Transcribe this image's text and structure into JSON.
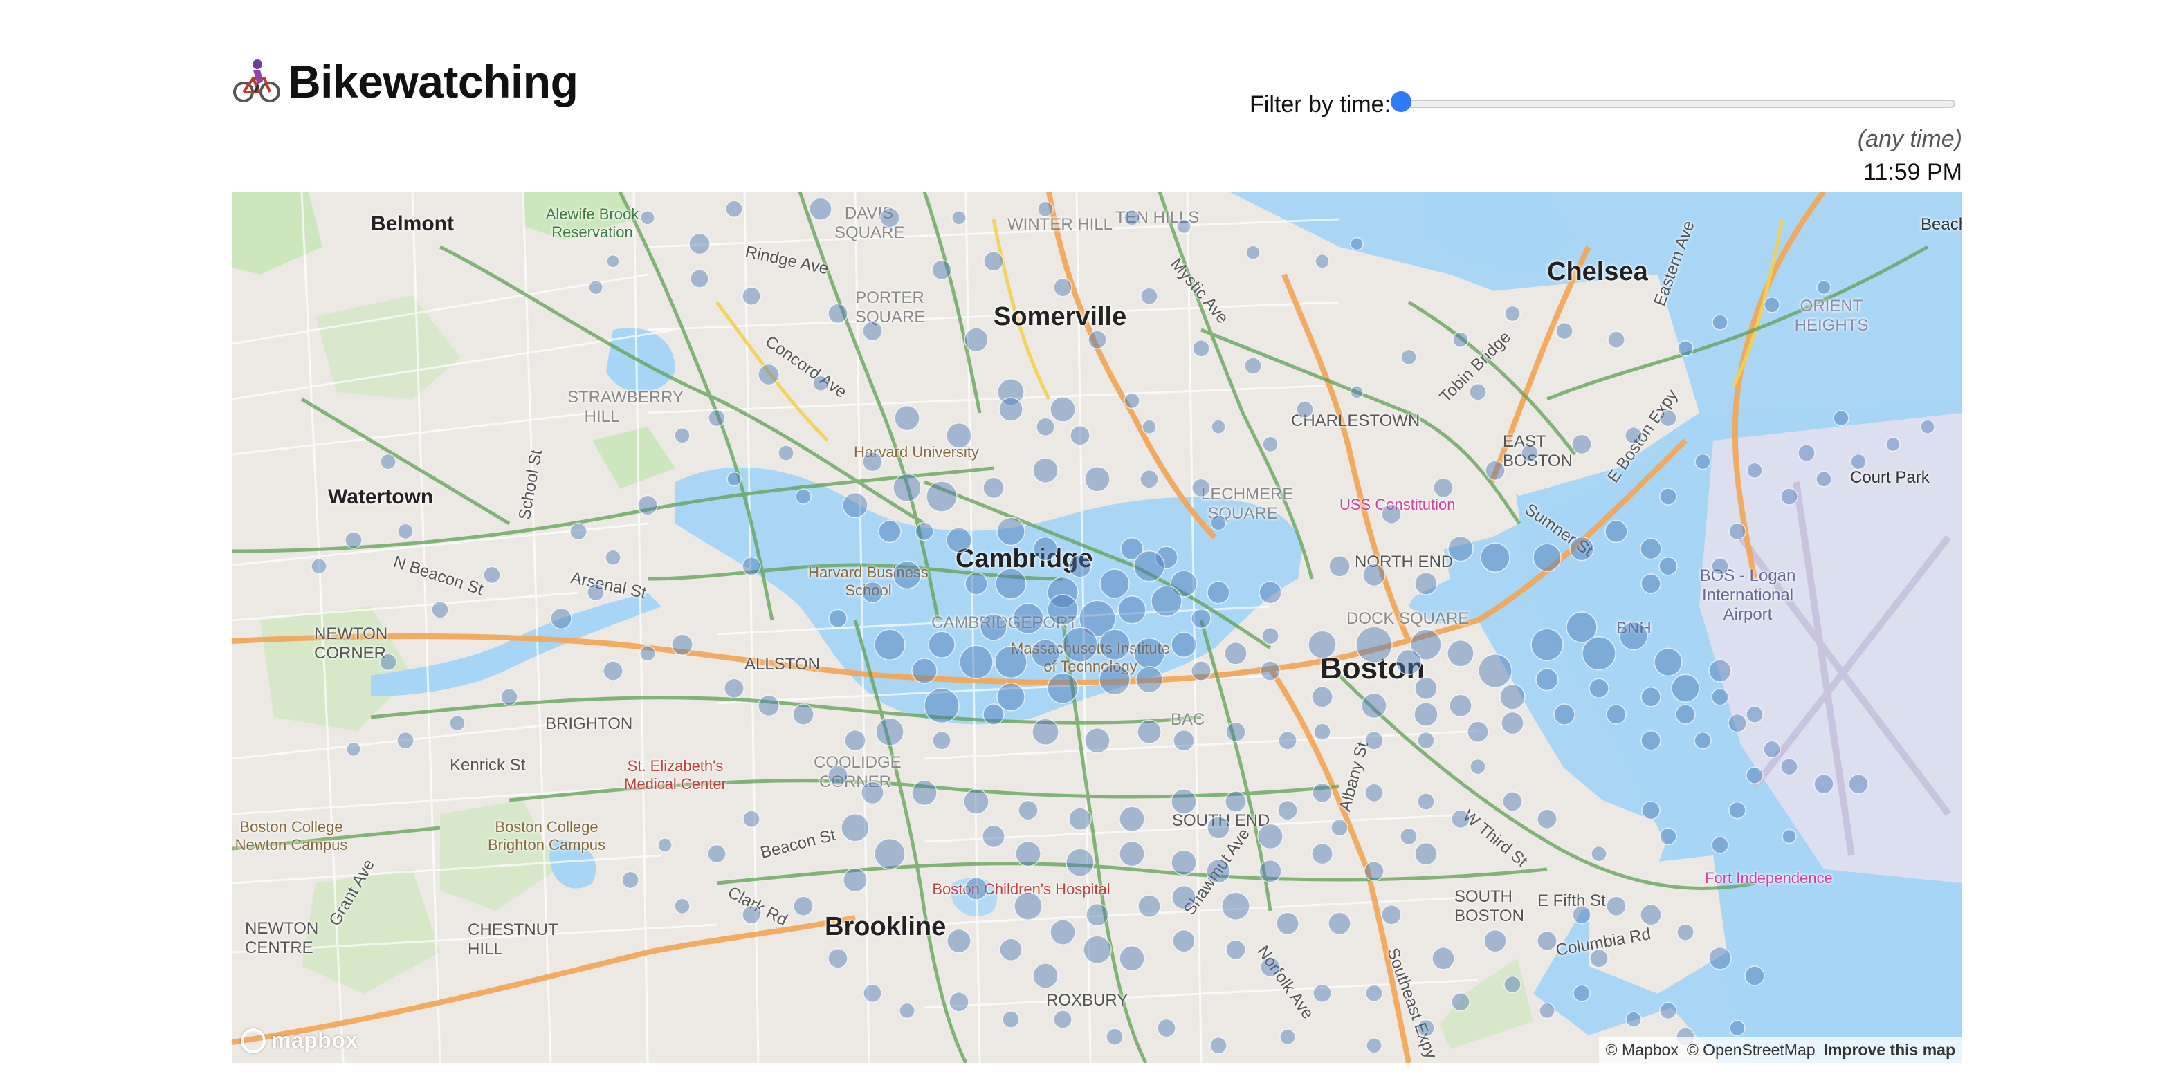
{
  "app": {
    "title": "Bikewatching",
    "title_icon": "bicycle-rider-icon"
  },
  "filter": {
    "label": "Filter by time:",
    "slider_value_fraction": 0.0,
    "any_time_text": "(any time)",
    "time_text": "11:59 PM",
    "accent_color": "#2f7bf5"
  },
  "map": {
    "labels": {
      "belmont": "Belmont",
      "alewife": "Alewife Brook Reservation",
      "somerville": "Somerville",
      "chelsea": "Chelsea",
      "watertown": "Watertown",
      "cambridge": "Cambridge",
      "boston": "Boston",
      "brookline": "Brookline",
      "harvard_university": "Harvard University",
      "harvard_business_school": "Harvard Business School",
      "mit": "Massachusetts Institute of Technology",
      "brighton": "BRIGHTON",
      "allston": "ALLSTON",
      "newton_corner": "NEWTON CORNER",
      "newton_centre": "NEWTON CENTRE",
      "chestnut_hill": "CHESTNUT HILL",
      "st_elizabeths": "St. Elizabeth's Medical Center",
      "boston_college_newton": "Boston College Newton Campus",
      "boston_college_brighton": "Boston College Brighton Campus",
      "childrens_hospital": "Boston Children's Hospital",
      "charlestown": "CHARLESTOWN",
      "east_boston": "EAST BOSTON",
      "north_end": "NORTH END",
      "south_end": "SOUTH END",
      "south_boston": "SOUTH BOSTON",
      "roxbury": "ROXBURY",
      "uss_constitution": "USS Constitution",
      "logan_airport": "BOS - Logan International Airport",
      "bnh": "BNH",
      "fort_independence": "Fort Independence",
      "court_park": "Court Park",
      "beach": "Beach",
      "orient_heights": "ORIENT HEIGHTS",
      "rindge_ave": "Rindge Ave",
      "concord_ave": "Concord Ave",
      "n_beacon_st": "N Beacon St",
      "arsenal_st": "Arsenal St",
      "kenrick_st": "Kenrick St",
      "beacon_st": "Beacon St",
      "clark_rd": "Clark Rd",
      "e_fifth_st": "E Fifth St",
      "columbia_rd": "Columbia Rd",
      "tobin_bridge": "Tobin Bridge",
      "strawberry_hill": "STRAWBERRY HILL",
      "porter_square": "PORTER SQUARE",
      "davis_square": "DAVIS SQUARE",
      "winter_hill": "WINTER HILL",
      "ten_hills": "TEN HILLS",
      "mystic_ave": "Mystic Ave",
      "eastern_ave": "Eastern Ave",
      "e_boston_expy": "E Boston Expy",
      "sumner_st": "Sumner St",
      "cambridgeport": "CAMBRIDGEPORT",
      "coolidge_corner": "COOLIDGE CORNER",
      "lechmere_square": "LECHMERE SQUARE",
      "dock_square": "DOCK SQUARE",
      "back_bay": "BAC",
      "w_third_st": "W Third St",
      "albany_st": "Albany St",
      "shawmut_ave": "Shawmut Ave",
      "norfolk_ave": "Norfolk Ave",
      "southeast_expy": "Southeast Expy",
      "grant_ave": "Grant Ave",
      "school_st": "School St"
    },
    "attribution": {
      "mapbox": "© Mapbox",
      "osm": "© OpenStreetMap",
      "improve": "Improve this map"
    },
    "logo_text": "mapbox",
    "station_color": "#4a78b5",
    "water_color": "#a6d5f5",
    "park_color": "#c9e7b8",
    "bikeway_color": "#5fa052",
    "highway_color": "#f2a85a"
  },
  "stations": [
    [
      0.24,
      0.03,
      10
    ],
    [
      0.29,
      0.02,
      12
    ],
    [
      0.34,
      0.02,
      16
    ],
    [
      0.38,
      0.03,
      14
    ],
    [
      0.42,
      0.03,
      10
    ],
    [
      0.47,
      0.02,
      11
    ],
    [
      0.52,
      0.03,
      11
    ],
    [
      0.55,
      0.04,
      10
    ],
    [
      0.59,
      0.07,
      10
    ],
    [
      0.63,
      0.08,
      10
    ],
    [
      0.65,
      0.06,
      9
    ],
    [
      0.27,
      0.06,
      15
    ],
    [
      0.27,
      0.1,
      13
    ],
    [
      0.22,
      0.08,
      9
    ],
    [
      0.21,
      0.11,
      10
    ],
    [
      0.3,
      0.12,
      13
    ],
    [
      0.35,
      0.14,
      14
    ],
    [
      0.41,
      0.09,
      14
    ],
    [
      0.44,
      0.08,
      14
    ],
    [
      0.48,
      0.11,
      13
    ],
    [
      0.53,
      0.12,
      12
    ],
    [
      0.37,
      0.16,
      14
    ],
    [
      0.43,
      0.17,
      17
    ],
    [
      0.45,
      0.23,
      19
    ],
    [
      0.48,
      0.25,
      18
    ],
    [
      0.5,
      0.17,
      13
    ],
    [
      0.52,
      0.24,
      11
    ],
    [
      0.56,
      0.18,
      12
    ],
    [
      0.59,
      0.2,
      12
    ],
    [
      0.62,
      0.25,
      12
    ],
    [
      0.65,
      0.23,
      9
    ],
    [
      0.31,
      0.21,
      15
    ],
    [
      0.34,
      0.22,
      11
    ],
    [
      0.39,
      0.26,
      18
    ],
    [
      0.42,
      0.28,
      18
    ],
    [
      0.45,
      0.25,
      17
    ],
    [
      0.47,
      0.27,
      13
    ],
    [
      0.49,
      0.28,
      14
    ],
    [
      0.53,
      0.27,
      10
    ],
    [
      0.57,
      0.27,
      10
    ],
    [
      0.6,
      0.29,
      11
    ],
    [
      0.28,
      0.26,
      12
    ],
    [
      0.32,
      0.3,
      11
    ],
    [
      0.37,
      0.31,
      14
    ],
    [
      0.39,
      0.34,
      20
    ],
    [
      0.41,
      0.35,
      22
    ],
    [
      0.44,
      0.34,
      15
    ],
    [
      0.47,
      0.32,
      18
    ],
    [
      0.5,
      0.33,
      18
    ],
    [
      0.53,
      0.33,
      13
    ],
    [
      0.56,
      0.34,
      13
    ],
    [
      0.36,
      0.36,
      18
    ],
    [
      0.38,
      0.39,
      16
    ],
    [
      0.4,
      0.39,
      13
    ],
    [
      0.42,
      0.4,
      18
    ],
    [
      0.45,
      0.39,
      20
    ],
    [
      0.47,
      0.41,
      17
    ],
    [
      0.49,
      0.43,
      16
    ],
    [
      0.52,
      0.41,
      16
    ],
    [
      0.54,
      0.42,
      16
    ],
    [
      0.57,
      0.38,
      11
    ],
    [
      0.37,
      0.46,
      15
    ],
    [
      0.39,
      0.44,
      20
    ],
    [
      0.43,
      0.45,
      16
    ],
    [
      0.45,
      0.45,
      22
    ],
    [
      0.48,
      0.46,
      22
    ],
    [
      0.51,
      0.45,
      21
    ],
    [
      0.53,
      0.43,
      22
    ],
    [
      0.55,
      0.45,
      19
    ],
    [
      0.57,
      0.46,
      16
    ],
    [
      0.6,
      0.46,
      16
    ],
    [
      0.35,
      0.49,
      13
    ],
    [
      0.38,
      0.52,
      22
    ],
    [
      0.41,
      0.52,
      19
    ],
    [
      0.44,
      0.5,
      19
    ],
    [
      0.46,
      0.49,
      22
    ],
    [
      0.48,
      0.48,
      22
    ],
    [
      0.5,
      0.49,
      26
    ],
    [
      0.52,
      0.48,
      20
    ],
    [
      0.54,
      0.47,
      22
    ],
    [
      0.56,
      0.49,
      14
    ],
    [
      0.4,
      0.55,
      18
    ],
    [
      0.43,
      0.54,
      24
    ],
    [
      0.45,
      0.54,
      23
    ],
    [
      0.47,
      0.53,
      20
    ],
    [
      0.49,
      0.52,
      25
    ],
    [
      0.51,
      0.52,
      22
    ],
    [
      0.53,
      0.53,
      22
    ],
    [
      0.55,
      0.52,
      18
    ],
    [
      0.58,
      0.53,
      16
    ],
    [
      0.6,
      0.51,
      12
    ],
    [
      0.41,
      0.59,
      25
    ],
    [
      0.45,
      0.58,
      20
    ],
    [
      0.48,
      0.57,
      22
    ],
    [
      0.51,
      0.56,
      22
    ],
    [
      0.53,
      0.56,
      19
    ],
    [
      0.56,
      0.55,
      14
    ],
    [
      0.6,
      0.55,
      14
    ],
    [
      0.63,
      0.52,
      20
    ],
    [
      0.66,
      0.52,
      26
    ],
    [
      0.69,
      0.52,
      22
    ],
    [
      0.64,
      0.43,
      15
    ],
    [
      0.66,
      0.44,
      16
    ],
    [
      0.69,
      0.45,
      16
    ],
    [
      0.71,
      0.41,
      18
    ],
    [
      0.73,
      0.42,
      21
    ],
    [
      0.76,
      0.42,
      20
    ],
    [
      0.78,
      0.41,
      17
    ],
    [
      0.8,
      0.39,
      16
    ],
    [
      0.82,
      0.41,
      15
    ],
    [
      0.83,
      0.43,
      13
    ],
    [
      0.67,
      0.37,
      14
    ],
    [
      0.7,
      0.34,
      14
    ],
    [
      0.73,
      0.32,
      14
    ],
    [
      0.75,
      0.3,
      12
    ],
    [
      0.78,
      0.29,
      14
    ],
    [
      0.81,
      0.28,
      12
    ],
    [
      0.83,
      0.26,
      12
    ],
    [
      0.85,
      0.31,
      11
    ],
    [
      0.83,
      0.35,
      12
    ],
    [
      0.82,
      0.45,
      14
    ],
    [
      0.68,
      0.54,
      18
    ],
    [
      0.71,
      0.53,
      19
    ],
    [
      0.73,
      0.55,
      24
    ],
    [
      0.76,
      0.52,
      23
    ],
    [
      0.78,
      0.5,
      22
    ],
    [
      0.79,
      0.53,
      24
    ],
    [
      0.81,
      0.51,
      20
    ],
    [
      0.83,
      0.54,
      20
    ],
    [
      0.84,
      0.57,
      20
    ],
    [
      0.86,
      0.55,
      16
    ],
    [
      0.69,
      0.57,
      16
    ],
    [
      0.71,
      0.59,
      16
    ],
    [
      0.74,
      0.58,
      18
    ],
    [
      0.76,
      0.56,
      16
    ],
    [
      0.79,
      0.57,
      14
    ],
    [
      0.82,
      0.58,
      14
    ],
    [
      0.84,
      0.6,
      14
    ],
    [
      0.86,
      0.58,
      12
    ],
    [
      0.87,
      0.61,
      13
    ],
    [
      0.88,
      0.6,
      12
    ],
    [
      0.63,
      0.58,
      15
    ],
    [
      0.66,
      0.59,
      18
    ],
    [
      0.69,
      0.6,
      17
    ],
    [
      0.72,
      0.62,
      15
    ],
    [
      0.74,
      0.61,
      16
    ],
    [
      0.77,
      0.6,
      15
    ],
    [
      0.8,
      0.6,
      14
    ],
    [
      0.82,
      0.63,
      14
    ],
    [
      0.85,
      0.63,
      12
    ],
    [
      0.89,
      0.64,
      12
    ],
    [
      0.47,
      0.62,
      19
    ],
    [
      0.5,
      0.63,
      18
    ],
    [
      0.53,
      0.62,
      17
    ],
    [
      0.55,
      0.63,
      15
    ],
    [
      0.58,
      0.62,
      14
    ],
    [
      0.61,
      0.63,
      13
    ],
    [
      0.63,
      0.62,
      12
    ],
    [
      0.66,
      0.63,
      13
    ],
    [
      0.69,
      0.63,
      12
    ],
    [
      0.72,
      0.66,
      11
    ],
    [
      0.44,
      0.6,
      15
    ],
    [
      0.41,
      0.63,
      13
    ],
    [
      0.38,
      0.62,
      20
    ],
    [
      0.36,
      0.63,
      15
    ],
    [
      0.33,
      0.6,
      15
    ],
    [
      0.31,
      0.59,
      15
    ],
    [
      0.29,
      0.57,
      14
    ],
    [
      0.26,
      0.52,
      15
    ],
    [
      0.24,
      0.53,
      11
    ],
    [
      0.22,
      0.55,
      14
    ],
    [
      0.19,
      0.49,
      15
    ],
    [
      0.16,
      0.58,
      12
    ],
    [
      0.13,
      0.61,
      11
    ],
    [
      0.1,
      0.63,
      12
    ],
    [
      0.07,
      0.64,
      10
    ],
    [
      0.09,
      0.54,
      12
    ],
    [
      0.12,
      0.48,
      12
    ],
    [
      0.15,
      0.44,
      12
    ],
    [
      0.2,
      0.39,
      12
    ],
    [
      0.24,
      0.36,
      14
    ],
    [
      0.35,
      0.67,
      14
    ],
    [
      0.37,
      0.69,
      16
    ],
    [
      0.4,
      0.69,
      18
    ],
    [
      0.43,
      0.7,
      18
    ],
    [
      0.46,
      0.71,
      14
    ],
    [
      0.49,
      0.72,
      16
    ],
    [
      0.52,
      0.72,
      18
    ],
    [
      0.55,
      0.7,
      18
    ],
    [
      0.57,
      0.73,
      16
    ],
    [
      0.6,
      0.74,
      18
    ],
    [
      0.44,
      0.74,
      16
    ],
    [
      0.46,
      0.76,
      18
    ],
    [
      0.49,
      0.77,
      20
    ],
    [
      0.52,
      0.76,
      18
    ],
    [
      0.55,
      0.77,
      18
    ],
    [
      0.57,
      0.78,
      17
    ],
    [
      0.6,
      0.78,
      16
    ],
    [
      0.63,
      0.76,
      15
    ],
    [
      0.66,
      0.78,
      14
    ],
    [
      0.69,
      0.76,
      16
    ],
    [
      0.36,
      0.73,
      20
    ],
    [
      0.38,
      0.76,
      22
    ],
    [
      0.3,
      0.72,
      12
    ],
    [
      0.28,
      0.76,
      13
    ],
    [
      0.25,
      0.75,
      10
    ],
    [
      0.23,
      0.79,
      12
    ],
    [
      0.26,
      0.82,
      11
    ],
    [
      0.3,
      0.83,
      13
    ],
    [
      0.33,
      0.82,
      14
    ],
    [
      0.36,
      0.79,
      17
    ],
    [
      0.43,
      0.8,
      16
    ],
    [
      0.46,
      0.82,
      20
    ],
    [
      0.48,
      0.85,
      18
    ],
    [
      0.5,
      0.83,
      16
    ],
    [
      0.53,
      0.82,
      16
    ],
    [
      0.55,
      0.81,
      17
    ],
    [
      0.58,
      0.82,
      20
    ],
    [
      0.61,
      0.84,
      16
    ],
    [
      0.64,
      0.84,
      16
    ],
    [
      0.67,
      0.83,
      14
    ],
    [
      0.42,
      0.86,
      17
    ],
    [
      0.45,
      0.87,
      16
    ],
    [
      0.47,
      0.9,
      18
    ],
    [
      0.5,
      0.87,
      20
    ],
    [
      0.52,
      0.88,
      18
    ],
    [
      0.55,
      0.86,
      16
    ],
    [
      0.58,
      0.87,
      14
    ],
    [
      0.6,
      0.89,
      14
    ],
    [
      0.63,
      0.92,
      13
    ],
    [
      0.66,
      0.92,
      12
    ],
    [
      0.35,
      0.88,
      14
    ],
    [
      0.37,
      0.92,
      13
    ],
    [
      0.39,
      0.94,
      11
    ],
    [
      0.42,
      0.93,
      14
    ],
    [
      0.45,
      0.95,
      12
    ],
    [
      0.48,
      0.95,
      13
    ],
    [
      0.51,
      0.97,
      12
    ],
    [
      0.54,
      0.96,
      13
    ],
    [
      0.57,
      0.98,
      12
    ],
    [
      0.61,
      0.97,
      11
    ],
    [
      0.7,
      0.88,
      16
    ],
    [
      0.73,
      0.86,
      16
    ],
    [
      0.76,
      0.86,
      14
    ],
    [
      0.78,
      0.83,
      13
    ],
    [
      0.8,
      0.82,
      14
    ],
    [
      0.82,
      0.83,
      15
    ],
    [
      0.84,
      0.85,
      12
    ],
    [
      0.86,
      0.88,
      16
    ],
    [
      0.88,
      0.9,
      14
    ],
    [
      0.79,
      0.88,
      13
    ],
    [
      0.71,
      0.93,
      13
    ],
    [
      0.74,
      0.91,
      12
    ],
    [
      0.76,
      0.94,
      11
    ],
    [
      0.78,
      0.92,
      12
    ],
    [
      0.81,
      0.95,
      11
    ],
    [
      0.83,
      0.94,
      12
    ],
    [
      0.84,
      0.97,
      13
    ],
    [
      0.87,
      0.96,
      11
    ],
    [
      0.69,
      0.96,
      12
    ],
    [
      0.66,
      0.98,
      11
    ],
    [
      0.88,
      0.67,
      12
    ],
    [
      0.9,
      0.66,
      12
    ],
    [
      0.92,
      0.68,
      14
    ],
    [
      0.94,
      0.68,
      14
    ],
    [
      0.86,
      0.75,
      12
    ],
    [
      0.83,
      0.74,
      12
    ],
    [
      0.82,
      0.71,
      13
    ],
    [
      0.87,
      0.71,
      12
    ],
    [
      0.9,
      0.74,
      10
    ],
    [
      0.79,
      0.76,
      11
    ],
    [
      0.74,
      0.7,
      14
    ],
    [
      0.76,
      0.72,
      14
    ],
    [
      0.71,
      0.72,
      13
    ],
    [
      0.69,
      0.7,
      12
    ],
    [
      0.66,
      0.69,
      13
    ],
    [
      0.63,
      0.69,
      14
    ],
    [
      0.61,
      0.71,
      14
    ],
    [
      0.58,
      0.7,
      15
    ],
    [
      0.64,
      0.73,
      12
    ],
    [
      0.68,
      0.74,
      12
    ],
    [
      0.09,
      0.31,
      11
    ],
    [
      0.07,
      0.4,
      12
    ],
    [
      0.1,
      0.39,
      11
    ],
    [
      0.05,
      0.43,
      11
    ],
    [
      0.21,
      0.46,
      12
    ],
    [
      0.22,
      0.42,
      11
    ],
    [
      0.26,
      0.28,
      11
    ],
    [
      0.29,
      0.33,
      10
    ],
    [
      0.33,
      0.35,
      11
    ],
    [
      0.3,
      0.43,
      13
    ],
    [
      0.87,
      0.39,
      12
    ],
    [
      0.86,
      0.43,
      12
    ],
    [
      0.9,
      0.35,
      12
    ],
    [
      0.92,
      0.33,
      11
    ],
    [
      0.94,
      0.31,
      11
    ],
    [
      0.96,
      0.29,
      10
    ],
    [
      0.98,
      0.27,
      10
    ],
    [
      0.88,
      0.32,
      11
    ],
    [
      0.91,
      0.3,
      12
    ],
    [
      0.93,
      0.26,
      11
    ],
    [
      0.92,
      0.11,
      10
    ],
    [
      0.89,
      0.13,
      11
    ],
    [
      0.86,
      0.15,
      11
    ],
    [
      0.84,
      0.18,
      11
    ],
    [
      0.8,
      0.17,
      12
    ],
    [
      0.77,
      0.16,
      12
    ],
    [
      0.74,
      0.14,
      11
    ],
    [
      0.71,
      0.17,
      11
    ],
    [
      0.68,
      0.19,
      11
    ],
    [
      0.72,
      0.23,
      12
    ]
  ]
}
